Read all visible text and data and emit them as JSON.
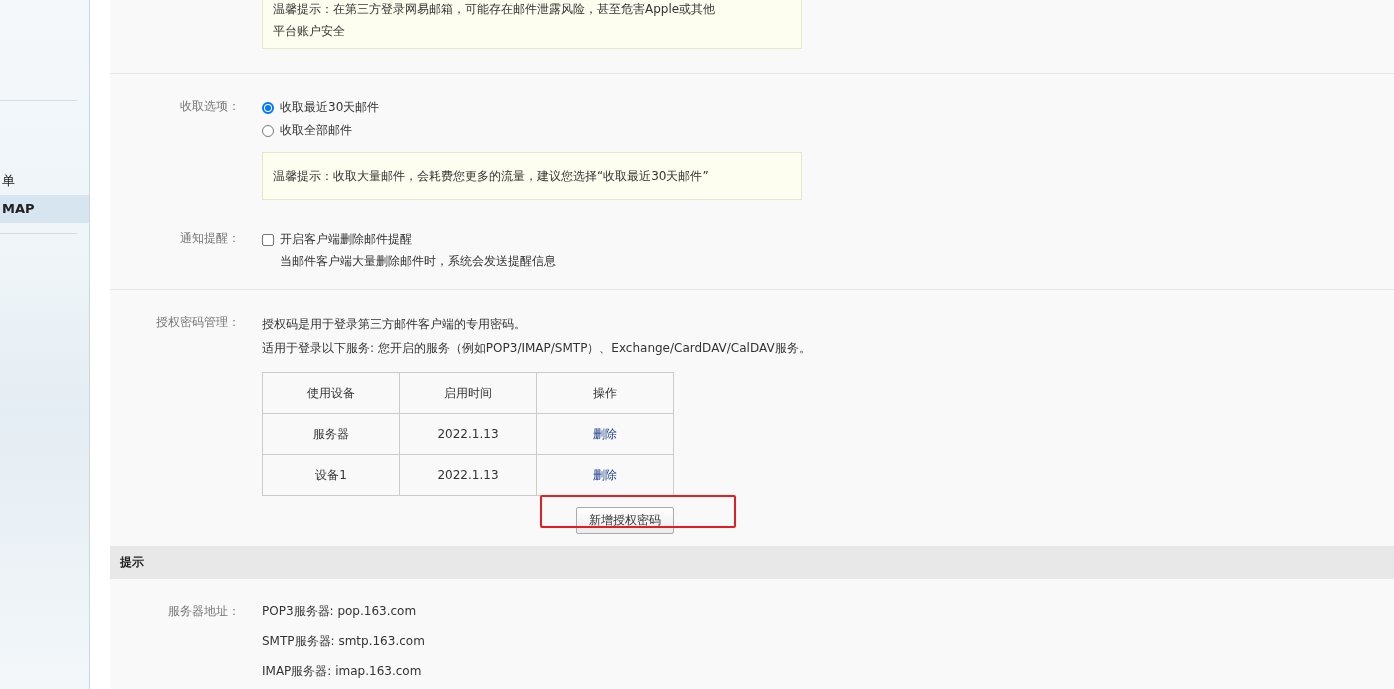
{
  "sidebar": {
    "items": [
      {
        "label": "单",
        "selected": false
      },
      {
        "label": "MAP",
        "selected": true
      }
    ]
  },
  "settings": {
    "top_notice": {
      "lines": [
        "温馨提示：在第三方登录网易邮箱，可能存在邮件泄露风险，甚至危害Apple或其他",
        "平台账户安全"
      ]
    },
    "fetch_options": {
      "label": "收取选项：",
      "options": [
        {
          "label": "收取最近30天邮件",
          "selected": true
        },
        {
          "label": "收取全部邮件",
          "selected": false
        }
      ],
      "notice": "温馨提示：收取大量邮件，会耗费您更多的流量，建议您选择“收取最近30天邮件”"
    },
    "notification": {
      "label": "通知提醒：",
      "checkbox": {
        "label": "开启客户端删除邮件提醒",
        "checked": false
      },
      "description": "当邮件客户端大量删除邮件时，系统会发送提醒信息"
    },
    "auth_password": {
      "label": "授权密码管理：",
      "description": [
        "授权码是用于登录第三方邮件客户端的专用密码。",
        "适用于登录以下服务: 您开启的服务（例如POP3/IMAP/SMTP）、Exchange/CardDAV/CalDAV服务。"
      ],
      "table": {
        "columns": [
          "使用设备",
          "启用时间",
          "操作"
        ],
        "rows": [
          [
            "服务器",
            "2022.1.13",
            "删除"
          ],
          [
            "设备1",
            "2022.1.13",
            "删除"
          ]
        ]
      },
      "add_button": "新增授权密码"
    }
  },
  "tips": {
    "title": "提示",
    "server_label": "服务器地址：",
    "servers": [
      "POP3服务器: pop.163.com",
      "SMTP服务器: smtp.163.com",
      "IMAP服务器: imap.163.com"
    ]
  }
}
